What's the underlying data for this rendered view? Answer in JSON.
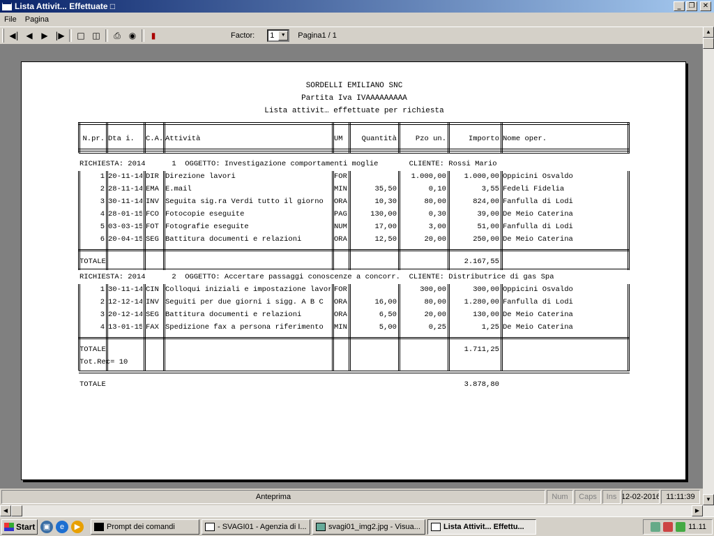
{
  "window": {
    "title": "Lista Attivit... Effettuate □"
  },
  "menu": [
    "File",
    "Pagina"
  ],
  "toolbar": {
    "factor_label": "Factor:",
    "factor_value": "1",
    "page_label": "Pagina1 / 1"
  },
  "report": {
    "company": "SORDELLI EMILIANO SNC",
    "vat": "Partita Iva  IVAAAAAAAAA",
    "subtitle": "Lista attivit… effettuate per richiesta",
    "columns": [
      "N.pr.",
      "Dta i.",
      "C.A.",
      "Attività",
      "UM",
      "Quantità",
      "Pzo un.",
      "Importo",
      "Nome oper."
    ],
    "groups": [
      {
        "header": "RICHIESTA: 2014      1  OGGETTO: Investigazione comportamenti moglie       CLIENTE: Rossi Mario",
        "rows": [
          [
            "1",
            "20-11-14",
            "DIR",
            "Direzione lavori",
            "FOR",
            "",
            "1.000,00",
            "1.000,00",
            "Oppicini Osvaldo"
          ],
          [
            "2",
            "28-11-14",
            "EMA",
            "E.mail",
            "MIN",
            "35,50",
            "0,10",
            "3,55",
            "Fedeli Fidelia"
          ],
          [
            "3",
            "30-11-14",
            "INV",
            "Seguita sig.ra Verdi tutto il giorno",
            "ORA",
            "10,30",
            "80,00",
            "824,00",
            "Fanfulla di Lodi"
          ],
          [
            "4",
            "28-01-15",
            "FCO",
            "Fotocopie eseguite",
            "PAG",
            "130,00",
            "0,30",
            "39,00",
            "De Meio Caterina"
          ],
          [
            "5",
            "03-03-15",
            "FOT",
            "Fotografie eseguite",
            "NUM",
            "17,00",
            "3,00",
            "51,00",
            "Fanfulla di Lodi"
          ],
          [
            "6",
            "20-04-15",
            "SEG",
            "Battitura documenti e relazioni",
            "ORA",
            "12,50",
            "20,00",
            "250,00",
            "De Meio Caterina"
          ]
        ],
        "total_label": "TOTALE",
        "total": "2.167,55"
      },
      {
        "header": "RICHIESTA: 2014      2  OGGETTO: Accertare passaggi conoscenze a concorr.  CLIENTE: Distributrice di gas Spa",
        "rows": [
          [
            "1",
            "30-11-14",
            "CIN",
            "Colloqui iniziali e impostazione lavoro",
            "FOR",
            "",
            "300,00",
            "300,00",
            "Oppicini Osvaldo"
          ],
          [
            "2",
            "12-12-14",
            "INV",
            "Seguiti per due giorni i sigg. A B C",
            "ORA",
            "16,00",
            "80,00",
            "1.280,00",
            "Fanfulla di Lodi"
          ],
          [
            "3",
            "20-12-14",
            "SEG",
            "Battitura documenti e relazioni",
            "ORA",
            "6,50",
            "20,00",
            "130,00",
            "De Meio Caterina"
          ],
          [
            "4",
            "13-01-15",
            "FAX",
            "Spedizione fax a persona riferimento",
            "MIN",
            "5,00",
            "0,25",
            "1,25",
            "De Meio Caterina"
          ]
        ],
        "total_label": "TOTALE",
        "total": "1.711,25"
      }
    ],
    "tot_rec": "Tot.Rec= 10",
    "grand_total_label": "TOTALE",
    "grand_total": "3.878,80"
  },
  "status": {
    "preview": "Anteprima",
    "num": "Num",
    "caps": "Caps",
    "ins": "Ins",
    "date": "12-02-2016",
    "time": "11:11:39"
  },
  "taskbar": {
    "start": "Start",
    "tasks": [
      "Prompt dei comandi",
      "- SVAGI01 - Agenzia di I...",
      "svagi01_img2.jpg - Visua...",
      "Lista Attivit... Effettu..."
    ],
    "clock": "11.11"
  }
}
